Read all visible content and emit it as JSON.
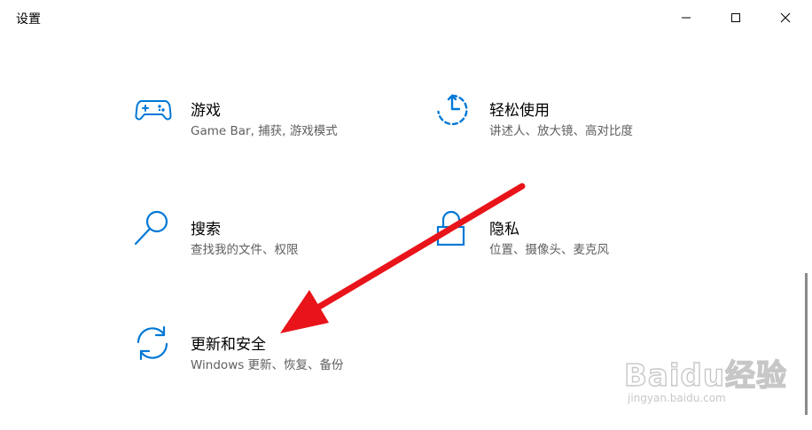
{
  "window": {
    "title": "设置",
    "minimize_icon": "minimize-icon",
    "maximize_icon": "maximize-icon",
    "close_icon": "close-icon"
  },
  "settings": [
    {
      "id": "gaming",
      "icon": "gamepad-icon",
      "title": "游戏",
      "description": "Game Bar, 捕获, 游戏模式"
    },
    {
      "id": "ease-of-access",
      "icon": "ease-of-access-icon",
      "title": "轻松使用",
      "description": "讲述人、放大镜、高对比度"
    },
    {
      "id": "search",
      "icon": "search-icon",
      "title": "搜索",
      "description": "查找我的文件、权限"
    },
    {
      "id": "privacy",
      "icon": "lock-icon",
      "title": "隐私",
      "description": "位置、摄像头、麦克风"
    },
    {
      "id": "update-security",
      "icon": "sync-icon",
      "title": "更新和安全",
      "description": "Windows 更新、恢复、备份"
    }
  ],
  "colors": {
    "accent": "#0078d7",
    "annotation_arrow": "#e8141a",
    "description_text": "#5f5f5f"
  },
  "watermark": {
    "brand": "Baidu经验",
    "url": "jingyan.baidu.com"
  }
}
